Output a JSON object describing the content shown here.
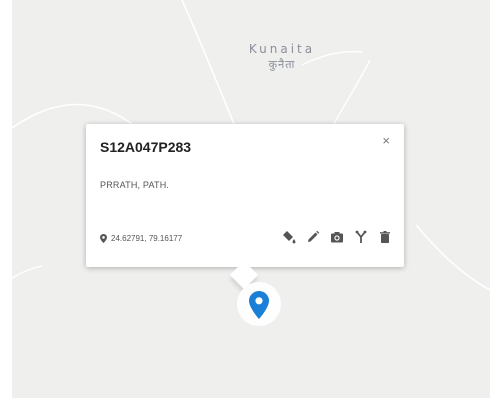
{
  "map": {
    "place_label_en": "Kunaita",
    "place_label_hi": "कुनैता"
  },
  "popup": {
    "title": "S12A047P283",
    "close_label": "×",
    "description": "PRRATH, PATH.",
    "coordinates": "24.62791, 79.16177",
    "tools": [
      {
        "name": "paint-bucket-icon"
      },
      {
        "name": "pencil-icon"
      },
      {
        "name": "camera-icon"
      },
      {
        "name": "branch-icon"
      },
      {
        "name": "trash-icon"
      }
    ]
  },
  "colors": {
    "marker": "#1a7fd6",
    "map_background": "#efefee",
    "road": "#ffffff"
  }
}
